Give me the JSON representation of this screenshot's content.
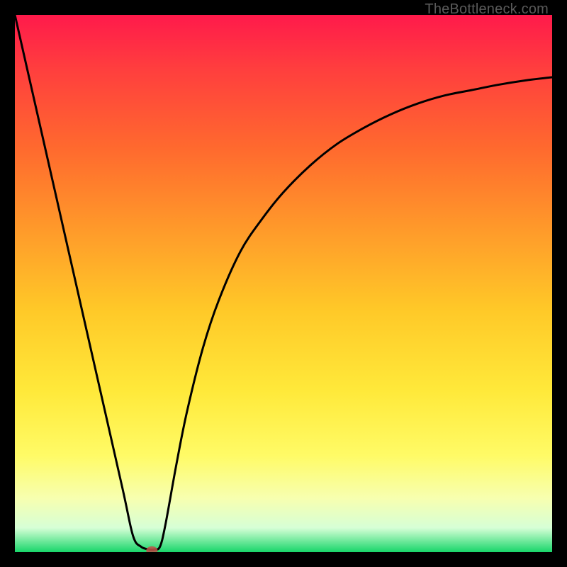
{
  "watermark": "TheBottleneck.com",
  "chart_data": {
    "type": "line",
    "title": "",
    "xlabel": "",
    "ylabel": "",
    "xlim": [
      0,
      100
    ],
    "ylim": [
      0,
      100
    ],
    "series": [
      {
        "name": "curve",
        "x": [
          0,
          5,
          10,
          15,
          20,
          22,
          23.5,
          25,
          26,
          27,
          28,
          30,
          32,
          35,
          38,
          42,
          46,
          50,
          55,
          60,
          65,
          70,
          75,
          80,
          85,
          90,
          95,
          100
        ],
        "y": [
          100,
          78,
          56,
          34,
          12,
          3,
          1,
          0.5,
          0.5,
          1,
          5,
          16,
          26,
          38,
          47,
          56,
          62,
          67,
          72,
          76,
          79,
          81.5,
          83.5,
          85,
          86,
          87,
          87.8,
          88.4
        ]
      }
    ],
    "marker": {
      "x": 25.5,
      "y": 0.3
    },
    "gradient_stops": [
      {
        "offset": 0.0,
        "color": "#ff1a4b"
      },
      {
        "offset": 0.1,
        "color": "#ff3e3e"
      },
      {
        "offset": 0.25,
        "color": "#ff6a2e"
      },
      {
        "offset": 0.4,
        "color": "#ff9a2a"
      },
      {
        "offset": 0.55,
        "color": "#ffc928"
      },
      {
        "offset": 0.7,
        "color": "#ffe93a"
      },
      {
        "offset": 0.82,
        "color": "#fffb66"
      },
      {
        "offset": 0.9,
        "color": "#f7ffb0"
      },
      {
        "offset": 0.955,
        "color": "#d6ffd6"
      },
      {
        "offset": 1.0,
        "color": "#18d66a"
      }
    ]
  }
}
